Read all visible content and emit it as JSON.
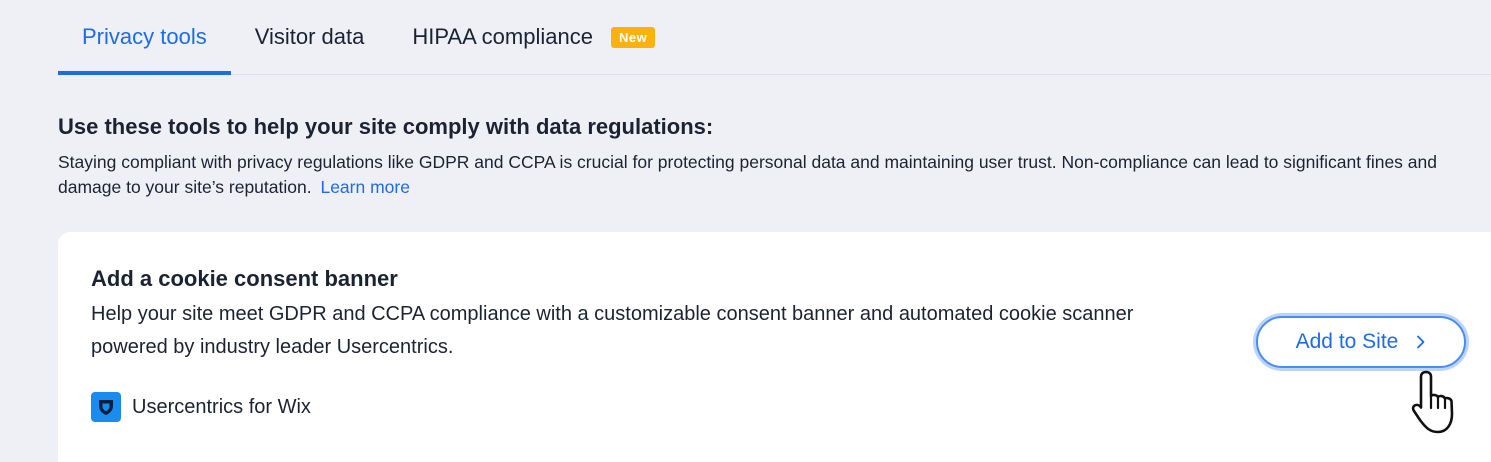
{
  "tabs": [
    {
      "label": "Privacy tools",
      "active": true
    },
    {
      "label": "Visitor data",
      "active": false
    },
    {
      "label": "HIPAA compliance",
      "active": false,
      "badge": "New"
    }
  ],
  "intro": {
    "heading": "Use these tools to help your site comply with data regulations:",
    "body": "Staying compliant with privacy regulations like GDPR and CCPA is crucial for protecting personal data and maintaining user trust. Non-compliance can lead to significant fines and damage to your site’s reputation.",
    "link_label": "Learn more"
  },
  "card": {
    "title": "Add a cookie consent banner",
    "description": "Help your site meet GDPR and CCPA compliance with a customizable consent banner and automated cookie scanner powered by industry leader Usercentrics.",
    "provider_name": "Usercentrics for Wix",
    "provider_icon": "shield-icon",
    "button_label": "Add to Site"
  },
  "colors": {
    "accent": "#1f6be5",
    "badge": "#fdb10c",
    "provider_logo": "#1a8cf0",
    "page_background": "#eef0f5",
    "card_background": "#ffffff"
  }
}
